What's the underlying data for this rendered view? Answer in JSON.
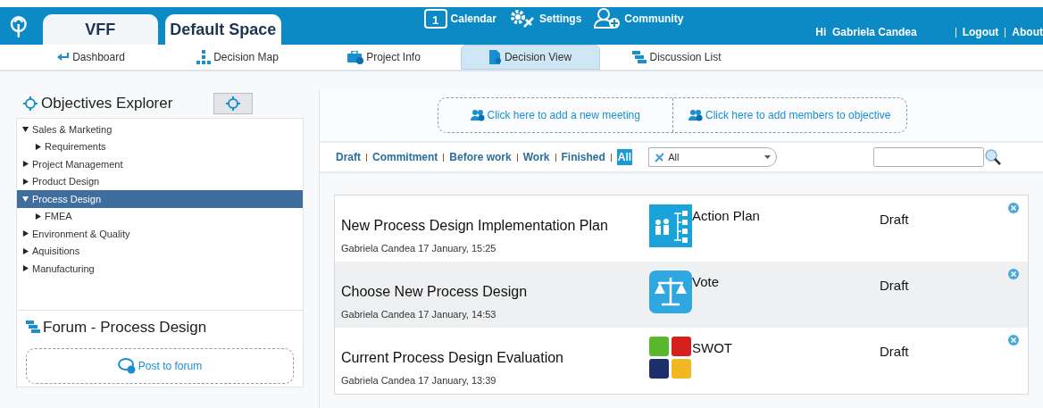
{
  "header": {
    "workspace_tabs": [
      {
        "label": "VFF",
        "selected": false
      },
      {
        "label": "Default Space",
        "selected": true
      }
    ],
    "links": [
      {
        "kind": "calendar",
        "label": "Calendar",
        "badge": "1"
      },
      {
        "kind": "settings",
        "label": "Settings"
      },
      {
        "kind": "community",
        "label": "Community"
      }
    ],
    "greeting": "Hi  Gabriela Candea",
    "account_links": [
      "Logout",
      "About"
    ]
  },
  "nav": [
    {
      "kind": "back",
      "label": "Dashboard",
      "selected": false
    },
    {
      "kind": "map",
      "label": "Decision Map",
      "selected": false
    },
    {
      "kind": "info",
      "label": "Project Info",
      "selected": false
    },
    {
      "kind": "view",
      "label": "Decision View",
      "selected": true
    },
    {
      "kind": "list",
      "label": "Discussion List",
      "selected": false
    }
  ],
  "objectives_explorer": {
    "title": "Objectives Explorer",
    "tree": [
      {
        "label": "Sales & Marketing",
        "expanded": true,
        "selected": false,
        "children": [
          {
            "label": "Requirements",
            "expanded": false,
            "selected": false
          }
        ]
      },
      {
        "label": "Project Management",
        "expanded": false,
        "selected": false
      },
      {
        "label": "Product Design",
        "expanded": false,
        "selected": false
      },
      {
        "label": "Process Design",
        "expanded": true,
        "selected": true,
        "children": [
          {
            "label": "FMEA",
            "expanded": false,
            "selected": false
          }
        ]
      },
      {
        "label": "Environment & Quality",
        "expanded": false,
        "selected": false
      },
      {
        "label": "Aquisitions",
        "expanded": false,
        "selected": false
      },
      {
        "label": "Manufacturing",
        "expanded": false,
        "selected": false
      }
    ]
  },
  "forum": {
    "title": "Forum - Process Design",
    "post_button": "Post to forum"
  },
  "actions": [
    "Click here to add a new meeting",
    "Click here to add members to objective"
  ],
  "filters": [
    {
      "label": "Draft",
      "selected": false
    },
    {
      "label": "Commitment",
      "selected": false
    },
    {
      "label": "Before work",
      "selected": false
    },
    {
      "label": "Work",
      "selected": false
    },
    {
      "label": "Finished",
      "selected": false
    },
    {
      "label": "All",
      "selected": true
    }
  ],
  "type_dropdown": {
    "value": "All"
  },
  "decisions": [
    {
      "title": "New Process Design Implementation Plan",
      "meta": "Gabriela Candea 17 January, 15:25",
      "kind": "action_plan",
      "type": "Action Plan",
      "status": "Draft"
    },
    {
      "title": "Choose New Process Design",
      "meta": "Gabriela Candea 17 January, 14:53",
      "kind": "vote",
      "type": "Vote",
      "status": "Draft"
    },
    {
      "title": "Current Process Design Evaluation",
      "meta": "Gabriela Candea 17 January, 13:39",
      "kind": "swot",
      "type": "SWOT",
      "status": "Draft"
    }
  ]
}
